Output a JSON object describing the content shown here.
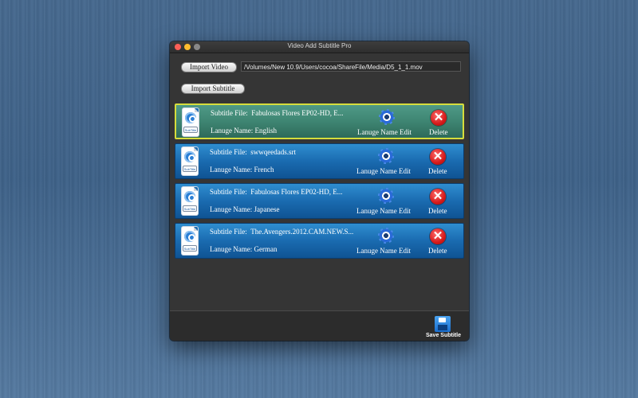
{
  "window": {
    "title": "Video Add Subtitle Pro"
  },
  "toolbar": {
    "import_video_label": "Import Video",
    "video_path": "/Volumes/New 10.9/Users/cocoa/ShareFile/Media/D5_1_1.mov",
    "import_subtitle_label": "Import Subtitle"
  },
  "subtitles": [
    {
      "file_label": "Subtitle File:",
      "file_name": "Fabulosas Flores EP02-HD, E...",
      "lang_label": "Lanuge Name:",
      "language": "English",
      "edit_label": "Lanuge Name Edit",
      "delete_label": "Delete",
      "icon_caption": "SubTitle",
      "selected": true
    },
    {
      "file_label": "Subtitle File:",
      "file_name": "swwqeedads.srt",
      "lang_label": "Lanuge Name:",
      "language": "French",
      "edit_label": "Lanuge Name Edit",
      "delete_label": "Delete",
      "icon_caption": "SubTitle",
      "selected": false
    },
    {
      "file_label": "Subtitle File:",
      "file_name": "Fabulosas Flores EP02-HD, E...",
      "lang_label": "Lanuge Name:",
      "language": "Japanese",
      "edit_label": "Lanuge Name Edit",
      "delete_label": "Delete",
      "icon_caption": "SubTitle",
      "selected": false
    },
    {
      "file_label": "Subtitle File:",
      "file_name": "The.Avengers.2012.CAM.NEW.S...",
      "lang_label": "Lanuge Name:",
      "language": "German",
      "edit_label": "Lanuge Name Edit",
      "delete_label": "Delete",
      "icon_caption": "SubTitle",
      "selected": false
    }
  ],
  "footer": {
    "save_label": "Save Subtitle"
  },
  "colors": {
    "row_blue": "#1a6bb0",
    "row_selected": "#3e8572",
    "selected_border": "#d6dd3c"
  }
}
